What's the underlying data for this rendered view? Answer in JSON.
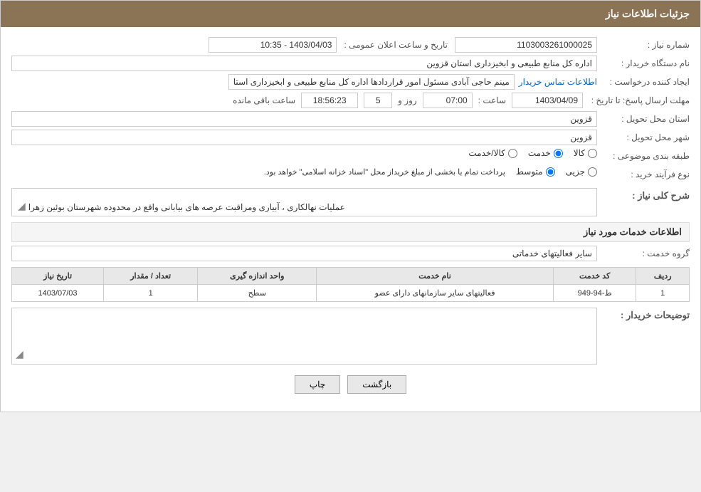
{
  "header": {
    "title": "جزئیات اطلاعات نیاز"
  },
  "fields": {
    "need_number_label": "شماره نیاز :",
    "need_number_value": "1103003261000025",
    "announce_date_label": "تاریخ و ساعت اعلان عمومی :",
    "announce_date_value": "1403/04/03 - 10:35",
    "buyer_org_label": "نام دستگاه خریدار :",
    "buyer_org_value": "اداره کل منابع طبیعی و ابخیزداری استان قزوین",
    "creator_label": "ایجاد کننده درخواست :",
    "creator_value": "مینم حاجی آبادی مسئول امور قراردادها اداره کل منابع طبیعی و ابخیزداری استا",
    "creator_link": "اطلاعات تماس خریدار",
    "deadline_label": "مهلت ارسال پاسخ: تا تاریخ :",
    "deadline_date": "1403/04/09",
    "deadline_time_label": "ساعت :",
    "deadline_time": "07:00",
    "deadline_day_label": "روز و",
    "deadline_days": "5",
    "deadline_remain_label": "ساعت باقی مانده",
    "deadline_remain": "18:56:23",
    "province_label": "استان محل تحویل :",
    "province_value": "قزوین",
    "city_label": "شهر محل تحویل :",
    "city_value": "قزوین",
    "category_label": "طبقه بندی موضوعی :",
    "category_goods": "کالا",
    "category_service": "خدمت",
    "category_goods_service": "کالا/خدمت",
    "purchase_type_label": "نوع فرآیند خرید :",
    "purchase_partial": "جزیی",
    "purchase_medium": "متوسط",
    "purchase_note": "پرداخت تمام یا بخشی از مبلغ خریداز محل \"اسناد خزانه اسلامی\" خواهد بود.",
    "description_label": "شرح کلی نیاز :",
    "description_value": "عملیات نهالکاری ، آبیاری ومراقبت عرصه های بیابانی واقع در محدوده شهرستان بوئین زهرا",
    "services_section": "اطلاعات خدمات مورد نیاز",
    "service_group_label": "گروه خدمت :",
    "service_group_value": "سایر فعالیتهای خدماتی",
    "table": {
      "columns": [
        "ردیف",
        "کد خدمت",
        "نام خدمت",
        "واحد اندازه گیری",
        "تعداد / مقدار",
        "تاریخ نیاز"
      ],
      "rows": [
        {
          "row": "1",
          "code": "ط-94-949",
          "name": "فعالیتهای سایر سازمانهای دارای عضو",
          "unit": "سطح",
          "qty": "1",
          "date": "1403/07/03"
        }
      ]
    },
    "buyer_desc_label": "توضیحات خریدار :",
    "buyer_desc_value": "",
    "btn_print": "چاپ",
    "btn_back": "بازگشت"
  }
}
